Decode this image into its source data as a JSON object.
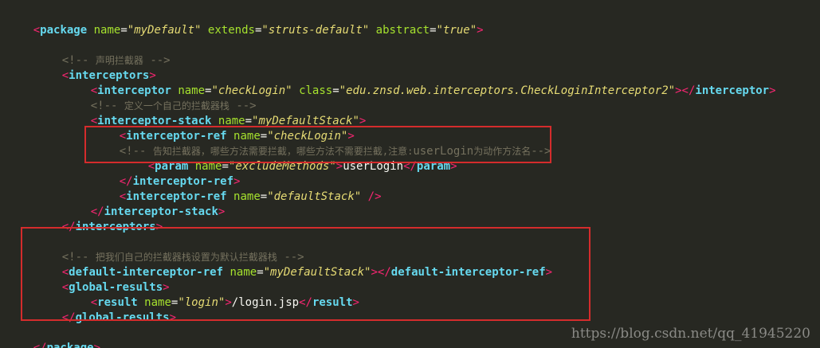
{
  "code": {
    "l1": {
      "lt": "<",
      "tag": "package",
      "a1": "name",
      "v1": "\"myDefault\"",
      "a2": "extends",
      "v2": "\"struts-default\"",
      "a3": "abstract",
      "v3": "\"true\"",
      "gt": ">"
    },
    "l3": {
      "open": "<!--",
      "text": "声明拦截器",
      "close": "-->"
    },
    "l4": {
      "lt": "<",
      "tag": "interceptors",
      "gt": ">"
    },
    "l5": {
      "lt": "<",
      "tag": "interceptor",
      "a1": "name",
      "v1": "\"checkLogin\"",
      "a2": "class",
      "v2": "\"edu.znsd.web.interceptors.CheckLoginInterceptor2\"",
      "gt": ">",
      "clt": "</",
      "ctag": "interceptor",
      "cgt": ">"
    },
    "l6": {
      "open": "<!--",
      "text": "定义一个自己的拦截器栈",
      "close": "-->"
    },
    "l7": {
      "lt": "<",
      "tag": "interceptor-stack",
      "a1": "name",
      "v1": "\"myDefaultStack\"",
      "gt": ">"
    },
    "l8": {
      "lt": "<",
      "tag": "interceptor-ref",
      "a1": "name",
      "v1": "\"checkLogin\"",
      "gt": ">"
    },
    "l9": {
      "open": "<!--",
      "text1": "告知拦截器，哪些方法需要拦截，哪些方法不需要拦截,注意:",
      "mono": "userLogin",
      "text2": "为动作方法名",
      "close": "-->"
    },
    "l10": {
      "lt": "<",
      "tag": "param",
      "a1": "name",
      "v1": "\"excludeMethods\"",
      "gt": ">",
      "text": "userLogin",
      "clt": "</",
      "ctag": "param",
      "cgt": ">"
    },
    "l11": {
      "lt": "</",
      "tag": "interceptor-ref",
      "gt": ">"
    },
    "l12": {
      "lt": "<",
      "tag": "interceptor-ref",
      "a1": "name",
      "v1": "\"defaultStack\"",
      "end": "/>"
    },
    "l13": {
      "lt": "</",
      "tag": "interceptor-stack",
      "gt": ">"
    },
    "l14": {
      "lt": "</",
      "tag": "interceptors",
      "gt": ">"
    },
    "l16": {
      "open": "<!--",
      "text": "把我们自己的拦截器栈设置为默认拦截器栈",
      "close": "-->"
    },
    "l17": {
      "lt": "<",
      "tag": "default-interceptor-ref",
      "a1": "name",
      "v1": "\"myDefaultStack\"",
      "gt": ">",
      "clt": "</",
      "ctag": "default-interceptor-ref",
      "cgt": ">"
    },
    "l18": {
      "lt": "<",
      "tag": "global-results",
      "gt": ">"
    },
    "l19": {
      "lt": "<",
      "tag": "result",
      "a1": "name",
      "v1": "\"login\"",
      "gt": ">",
      "text": "/login.jsp",
      "clt": "</",
      "ctag": "result",
      "cgt": ">"
    },
    "l20": {
      "lt": "</",
      "tag": "global-results",
      "gt": ">"
    },
    "l22": {
      "lt": "</",
      "tag": "package",
      "gt": ">"
    }
  },
  "watermark": "https://blog.csdn.net/qq_41945220",
  "colors": {
    "background": "#272822",
    "tag": "#66d9ef",
    "bracket": "#f92672",
    "attribute": "#a6e22e",
    "value": "#e6db74",
    "comment": "#75715e",
    "highlight_box": "#d42c2c"
  }
}
